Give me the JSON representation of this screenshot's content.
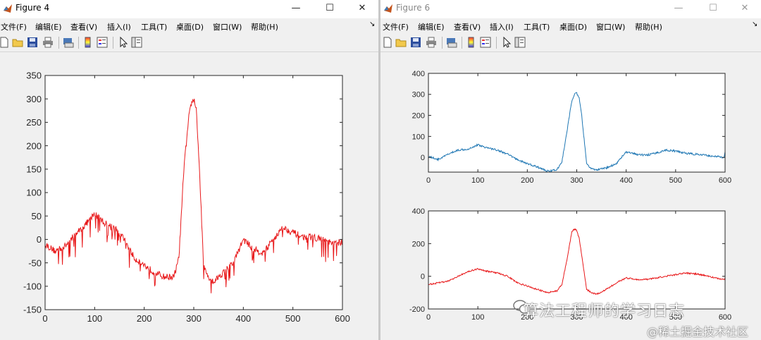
{
  "figure4": {
    "title": "Figure 4",
    "menu": [
      "文件(F)",
      "编辑(E)",
      "查看(V)",
      "插入(I)",
      "工具(T)",
      "桌面(D)",
      "窗口(W)",
      "帮助(H)"
    ],
    "controls": {
      "minimize": "—",
      "maximize": "☐",
      "close": "✕",
      "dock": "↘"
    }
  },
  "figure6": {
    "title": "Figure 6",
    "menu": [
      "文件(F)",
      "编辑(E)",
      "查看(V)",
      "插入(I)",
      "工具(T)",
      "桌面(D)",
      "窗口(W)",
      "帮助(H)"
    ],
    "controls": {
      "minimize": "—",
      "maximize": "☐",
      "close": "✕",
      "dock": "↘"
    }
  },
  "toolbar_icons": [
    "new-file-icon",
    "open-folder-icon",
    "save-icon",
    "print-icon",
    "print-preview-icon",
    "colorbar-icon",
    "legend-icon",
    "pointer-icon",
    "property-editor-icon"
  ],
  "watermarks": {
    "wechat": "算法工程师的学习日志",
    "juejin": "@稀土掘金技术社区"
  },
  "chart_data": [
    {
      "type": "line",
      "title": "",
      "xlabel": "",
      "ylabel": "",
      "xlim": [
        0,
        600
      ],
      "ylim": [
        -150,
        350
      ],
      "xticks": [
        0,
        100,
        200,
        300,
        400,
        500,
        600
      ],
      "yticks": [
        -150,
        -100,
        -50,
        0,
        50,
        100,
        150,
        200,
        250,
        300,
        350
      ],
      "color": "#e8191b",
      "noise": "spiky",
      "series": [
        {
          "x": [
            0,
            20,
            40,
            60,
            80,
            100,
            120,
            140,
            160,
            180,
            200,
            220,
            240,
            260,
            270,
            280,
            290,
            295,
            300,
            305,
            310,
            320,
            330,
            340,
            360,
            380,
            400,
            420,
            440,
            460,
            480,
            500,
            520,
            540,
            560,
            580,
            600
          ],
          "values": [
            -10,
            -25,
            -15,
            10,
            30,
            55,
            35,
            25,
            0,
            -40,
            -55,
            -70,
            -80,
            -80,
            -40,
            150,
            260,
            290,
            300,
            280,
            180,
            -60,
            -80,
            -90,
            -70,
            -50,
            0,
            -20,
            -30,
            0,
            25,
            15,
            5,
            5,
            0,
            -10,
            -5
          ]
        }
      ]
    },
    {
      "type": "line",
      "title": "",
      "xlabel": "",
      "ylabel": "",
      "xlim": [
        0,
        600
      ],
      "ylim": [
        -70,
        400
      ],
      "xticks": [
        0,
        100,
        200,
        300,
        400,
        500,
        600
      ],
      "yticks": [
        0,
        100,
        200,
        300,
        400
      ],
      "color": "#1f77b4",
      "noise": "smooth",
      "series": [
        {
          "x": [
            0,
            20,
            40,
            60,
            80,
            100,
            120,
            140,
            160,
            180,
            200,
            220,
            240,
            260,
            270,
            280,
            290,
            295,
            300,
            305,
            310,
            320,
            330,
            340,
            360,
            380,
            390,
            400,
            420,
            440,
            460,
            480,
            500,
            520,
            540,
            560,
            580,
            598,
            600
          ],
          "values": [
            5,
            -10,
            15,
            35,
            40,
            60,
            45,
            35,
            15,
            -10,
            -30,
            -45,
            -65,
            -60,
            -20,
            120,
            270,
            300,
            305,
            280,
            200,
            -30,
            -55,
            -60,
            -50,
            -30,
            0,
            25,
            15,
            10,
            20,
            35,
            30,
            20,
            15,
            10,
            5,
            0,
            30
          ]
        }
      ]
    },
    {
      "type": "line",
      "title": "",
      "xlabel": "",
      "ylabel": "",
      "xlim": [
        0,
        600
      ],
      "ylim": [
        -200,
        400
      ],
      "xticks": [
        0,
        100,
        200,
        300,
        400,
        500,
        600
      ],
      "yticks": [
        -200,
        0,
        200,
        400
      ],
      "color": "#e8191b",
      "noise": "smooth",
      "series": [
        {
          "x": [
            0,
            20,
            40,
            60,
            80,
            100,
            120,
            140,
            160,
            180,
            200,
            220,
            240,
            260,
            270,
            280,
            290,
            295,
            300,
            305,
            310,
            320,
            330,
            340,
            360,
            380,
            400,
            420,
            440,
            460,
            480,
            500,
            520,
            540,
            560,
            580,
            600
          ],
          "values": [
            -50,
            -40,
            -30,
            0,
            30,
            45,
            30,
            20,
            0,
            -40,
            -60,
            -80,
            -100,
            -90,
            -50,
            100,
            270,
            290,
            280,
            230,
            130,
            -80,
            -100,
            -110,
            -80,
            -40,
            -10,
            -20,
            -20,
            -10,
            0,
            10,
            20,
            15,
            5,
            -10,
            -20
          ]
        }
      ]
    }
  ]
}
